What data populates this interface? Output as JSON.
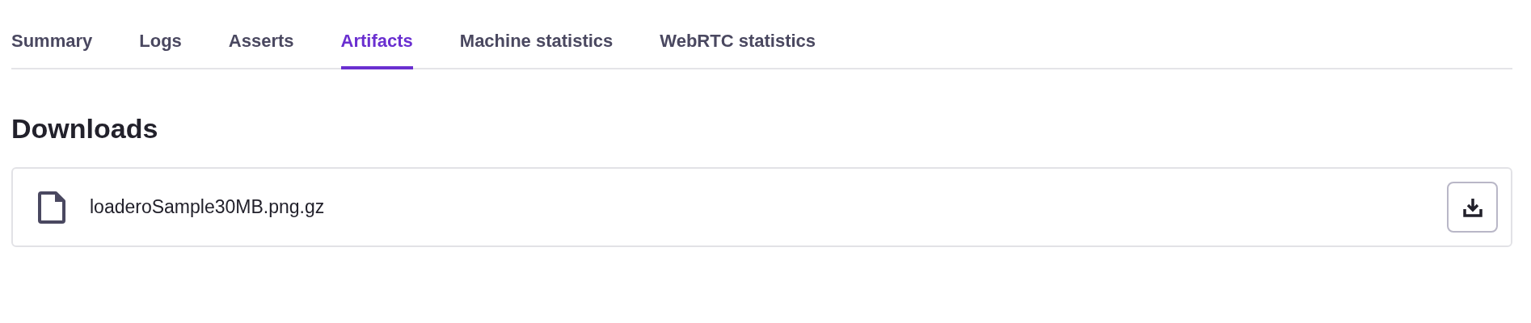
{
  "tabs": [
    {
      "label": "Summary",
      "selected": false
    },
    {
      "label": "Logs",
      "selected": false
    },
    {
      "label": "Asserts",
      "selected": false
    },
    {
      "label": "Artifacts",
      "selected": true
    },
    {
      "label": "Machine statistics",
      "selected": false
    },
    {
      "label": "WebRTC statistics",
      "selected": false
    }
  ],
  "section": {
    "title": "Downloads"
  },
  "files": [
    {
      "name": "loaderoSample30MB.png.gz"
    }
  ]
}
